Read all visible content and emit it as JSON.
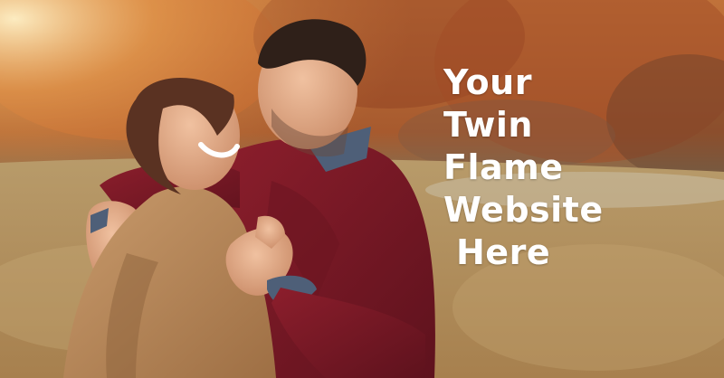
{
  "headline": {
    "lines": [
      "Your",
      "Twin",
      "Flame",
      "Website",
      "Here"
    ],
    "color": "#ffffff"
  }
}
